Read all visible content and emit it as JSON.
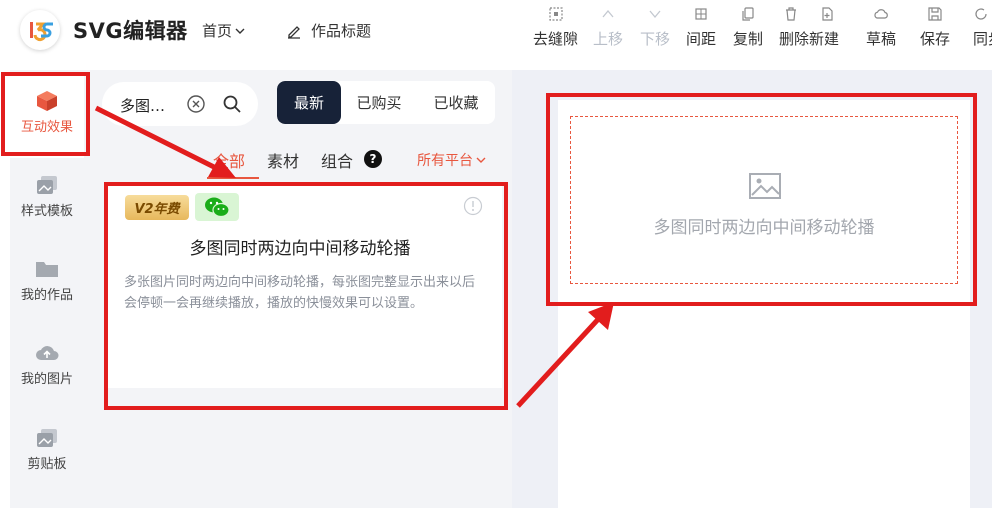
{
  "app": {
    "logo_text": "SVG编辑器",
    "nav_home": "首页",
    "nav_title": "作品标题"
  },
  "toolbar": {
    "remove_gap": "去缝隙",
    "move_up": "上移",
    "move_down": "下移",
    "spacing": "间距",
    "copy": "复制",
    "delete_new": "删除新建",
    "draft": "草稿",
    "save": "保存",
    "sync": "同步"
  },
  "rail": {
    "items": [
      {
        "label": "互动效果"
      },
      {
        "label": "样式模板"
      },
      {
        "label": "我的作品"
      },
      {
        "label": "我的图片"
      },
      {
        "label": "剪贴板"
      }
    ]
  },
  "search": {
    "value": "多图…"
  },
  "segments": {
    "latest": "最新",
    "purchased": "已购买",
    "favorited": "已收藏"
  },
  "tabs": {
    "all": "全部",
    "material": "素材",
    "combo": "组合",
    "help": "?",
    "platform": "所有平台"
  },
  "card": {
    "badge_v2": "V2年费",
    "title": "多图同时两边向中间移动轮播",
    "desc": "多张图片同时两边向中间移动轮播，每张图完整显示出来以后会停顿一会再继续播放，播放的快慢效果可以设置。"
  },
  "canvas": {
    "placeholder_text": "多图同时两边向中间移动轮播"
  },
  "colors": {
    "accent": "#e8573f",
    "annotation": "#e21d1d",
    "dark": "#172238"
  }
}
